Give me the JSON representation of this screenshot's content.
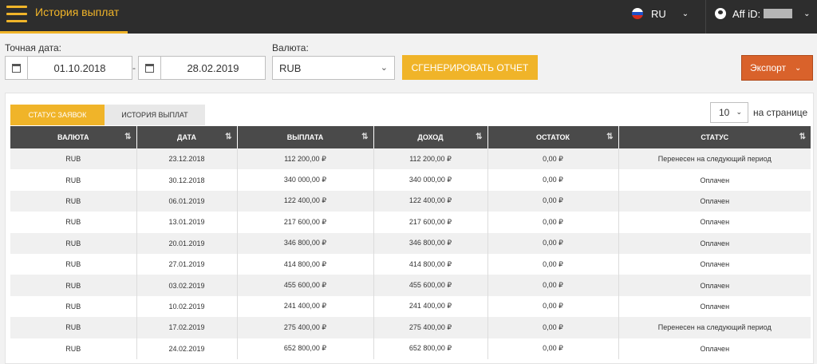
{
  "header": {
    "title": "История выплат",
    "lang": "RU",
    "aff_label": "Aff iD:"
  },
  "filters": {
    "date_label": "Точная дата:",
    "date_from": "01.10.2018",
    "date_to": "28.02.2019",
    "currency_label": "Валюта:",
    "currency_value": "RUB",
    "generate_label": "СГЕНЕРИРОВАТЬ ОТЧЕТ",
    "export_label": "Экспорт"
  },
  "tabs": [
    {
      "label": "СТАТУС ЗАЯВОК"
    },
    {
      "label": "ИСТОРИЯ ВЫПЛАТ"
    }
  ],
  "pagination": {
    "per_page_value": "10",
    "per_page_label": "на странице"
  },
  "table": {
    "columns": [
      "ВАЛЮТА",
      "ДАТА",
      "ВЫПЛАТА",
      "ДОХОД",
      "ОСТАТОК",
      "СТАТУС"
    ],
    "rows": [
      [
        "RUB",
        "23.12.2018",
        "112 200,00 ₽",
        "112 200,00 ₽",
        "0,00 ₽",
        "Перенесен на следующий период"
      ],
      [
        "RUB",
        "30.12.2018",
        "340 000,00 ₽",
        "340 000,00 ₽",
        "0,00 ₽",
        "Оплачен"
      ],
      [
        "RUB",
        "06.01.2019",
        "122 400,00 ₽",
        "122 400,00 ₽",
        "0,00 ₽",
        "Оплачен"
      ],
      [
        "RUB",
        "13.01.2019",
        "217 600,00 ₽",
        "217 600,00 ₽",
        "0,00 ₽",
        "Оплачен"
      ],
      [
        "RUB",
        "20.01.2019",
        "346 800,00 ₽",
        "346 800,00 ₽",
        "0,00 ₽",
        "Оплачен"
      ],
      [
        "RUB",
        "27.01.2019",
        "414 800,00 ₽",
        "414 800,00 ₽",
        "0,00 ₽",
        "Оплачен"
      ],
      [
        "RUB",
        "03.02.2019",
        "455 600,00 ₽",
        "455 600,00 ₽",
        "0,00 ₽",
        "Оплачен"
      ],
      [
        "RUB",
        "10.02.2019",
        "241 400,00 ₽",
        "241 400,00 ₽",
        "0,00 ₽",
        "Оплачен"
      ],
      [
        "RUB",
        "17.02.2019",
        "275 400,00 ₽",
        "275 400,00 ₽",
        "0,00 ₽",
        "Перенесен на следующий период"
      ],
      [
        "RUB",
        "24.02.2019",
        "652 800,00 ₽",
        "652 800,00 ₽",
        "0,00 ₽",
        "Оплачен"
      ]
    ]
  },
  "colors": {
    "accent": "#f0b429",
    "topbar": "#2d2d2d",
    "export": "#d9622b",
    "table_header": "#4a4a4a"
  },
  "icons": {
    "menu": "hamburger-icon",
    "calendar": "calendar-icon",
    "user": "user-icon",
    "flag": "russia-flag-icon",
    "sort": "sort-icon",
    "chevron": "chevron-down-icon"
  }
}
